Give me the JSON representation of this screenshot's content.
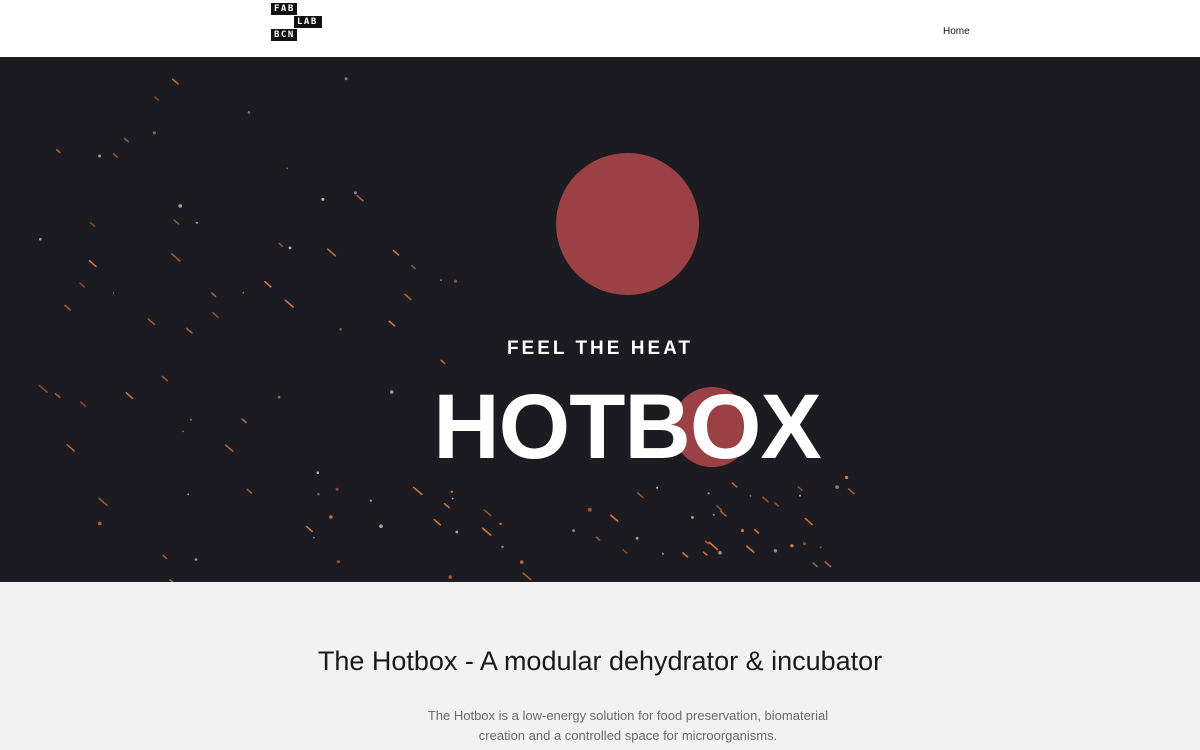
{
  "header": {
    "logo": [
      "FAB",
      "LAB",
      "BCN"
    ],
    "nav": {
      "home_label": "Home"
    }
  },
  "hero": {
    "tagline": "FEEL THE HEAT",
    "title": "HOTBOX",
    "colors": {
      "background": "#1c1b22",
      "accent": "#9b4146",
      "spark": "#e07a3a"
    }
  },
  "intro": {
    "title": "The Hotbox - A modular dehydrator & incubator",
    "description": "The Hotbox is a low-energy solution for food preservation, biomaterial creation and a controlled space for microorganisms."
  }
}
